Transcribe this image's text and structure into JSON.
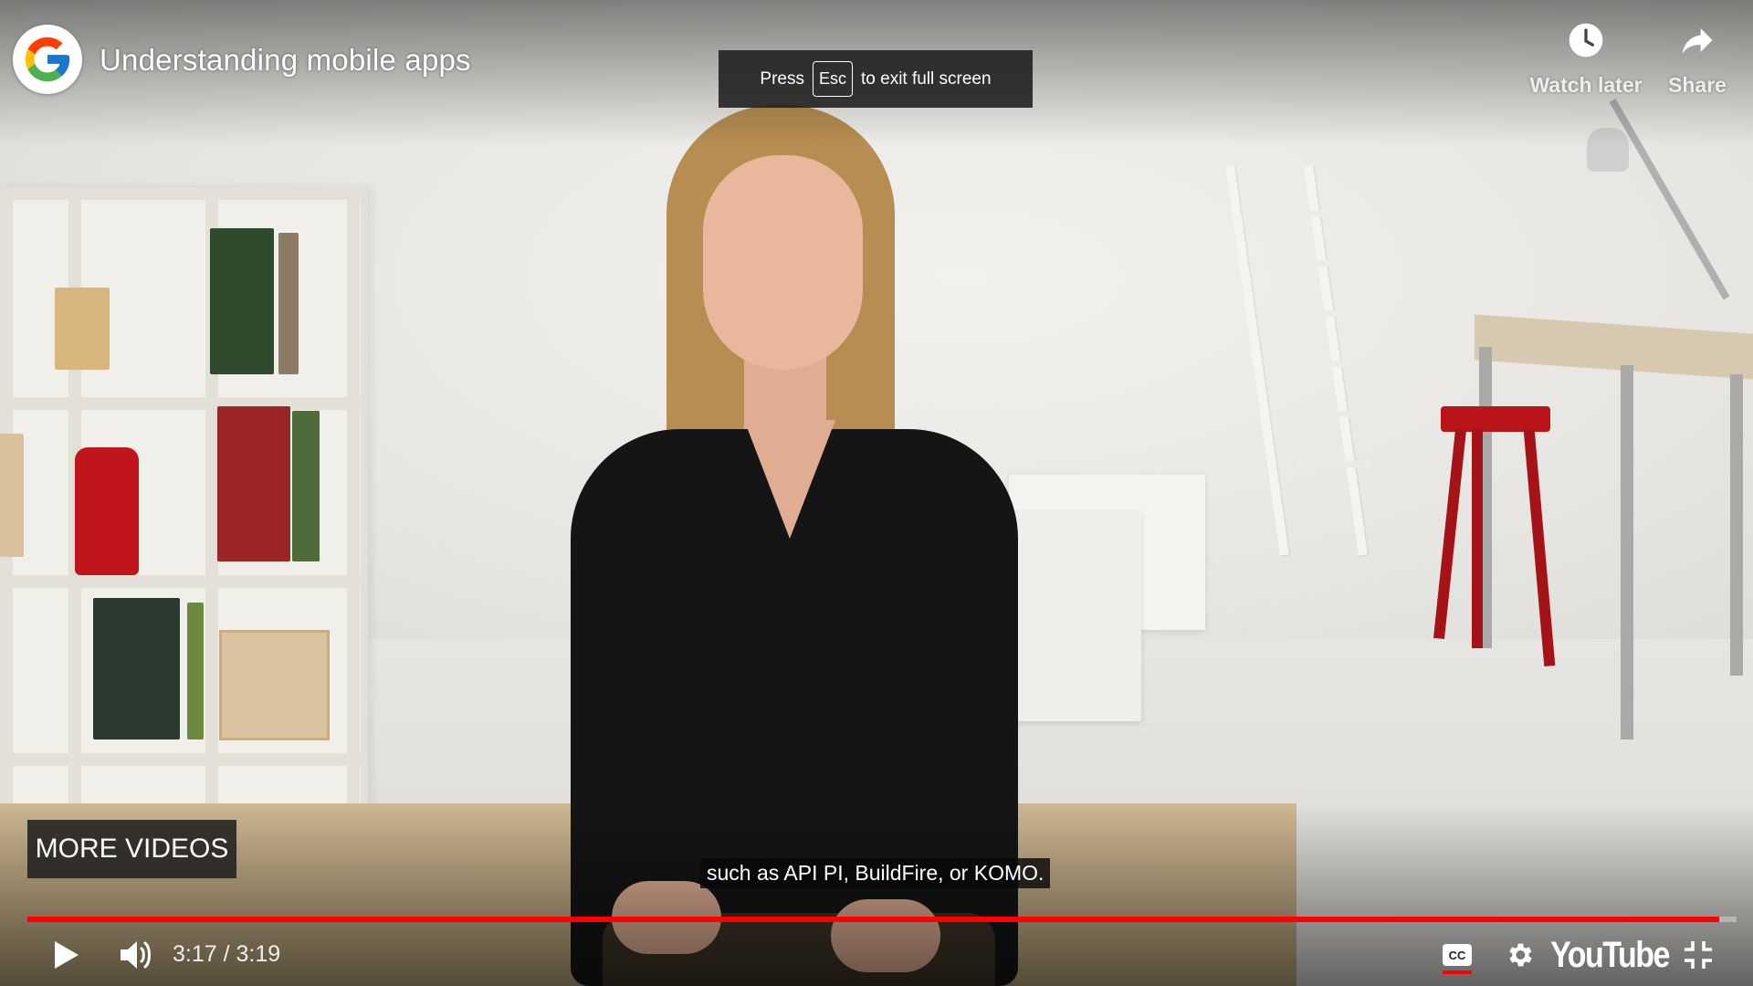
{
  "video": {
    "title": "Understanding mobile apps",
    "channel_logo_letter": "G"
  },
  "top_actions": {
    "watch_later": {
      "label": "Watch later",
      "icon": "clock-icon"
    },
    "share": {
      "label": "Share",
      "icon": "share-arrow-icon"
    }
  },
  "fullscreen_notice": {
    "prefix": "Press",
    "key": "Esc",
    "suffix": "to exit full screen"
  },
  "end_screen": {
    "more_videos_label": "MORE VIDEOS"
  },
  "captions": {
    "current_line": "such as API PI, BuildFire, or KOMO."
  },
  "playback": {
    "current_time": "3:17",
    "duration": "3:19",
    "time_display": "3:17 / 3:19",
    "progress_fraction": 0.99,
    "state": "paused"
  },
  "controls": {
    "play_icon": "play-icon",
    "volume_icon": "volume-icon",
    "subtitles_icon": "closed-captions-icon",
    "subtitles_on": true,
    "settings_icon": "gear-icon",
    "brand_logo": "YouTube",
    "exit_fullscreen_icon": "exit-fullscreen-icon"
  },
  "colors": {
    "progress": "#ff0000",
    "overlay_bg": "#1c1c1c",
    "text": "#ffffff"
  }
}
